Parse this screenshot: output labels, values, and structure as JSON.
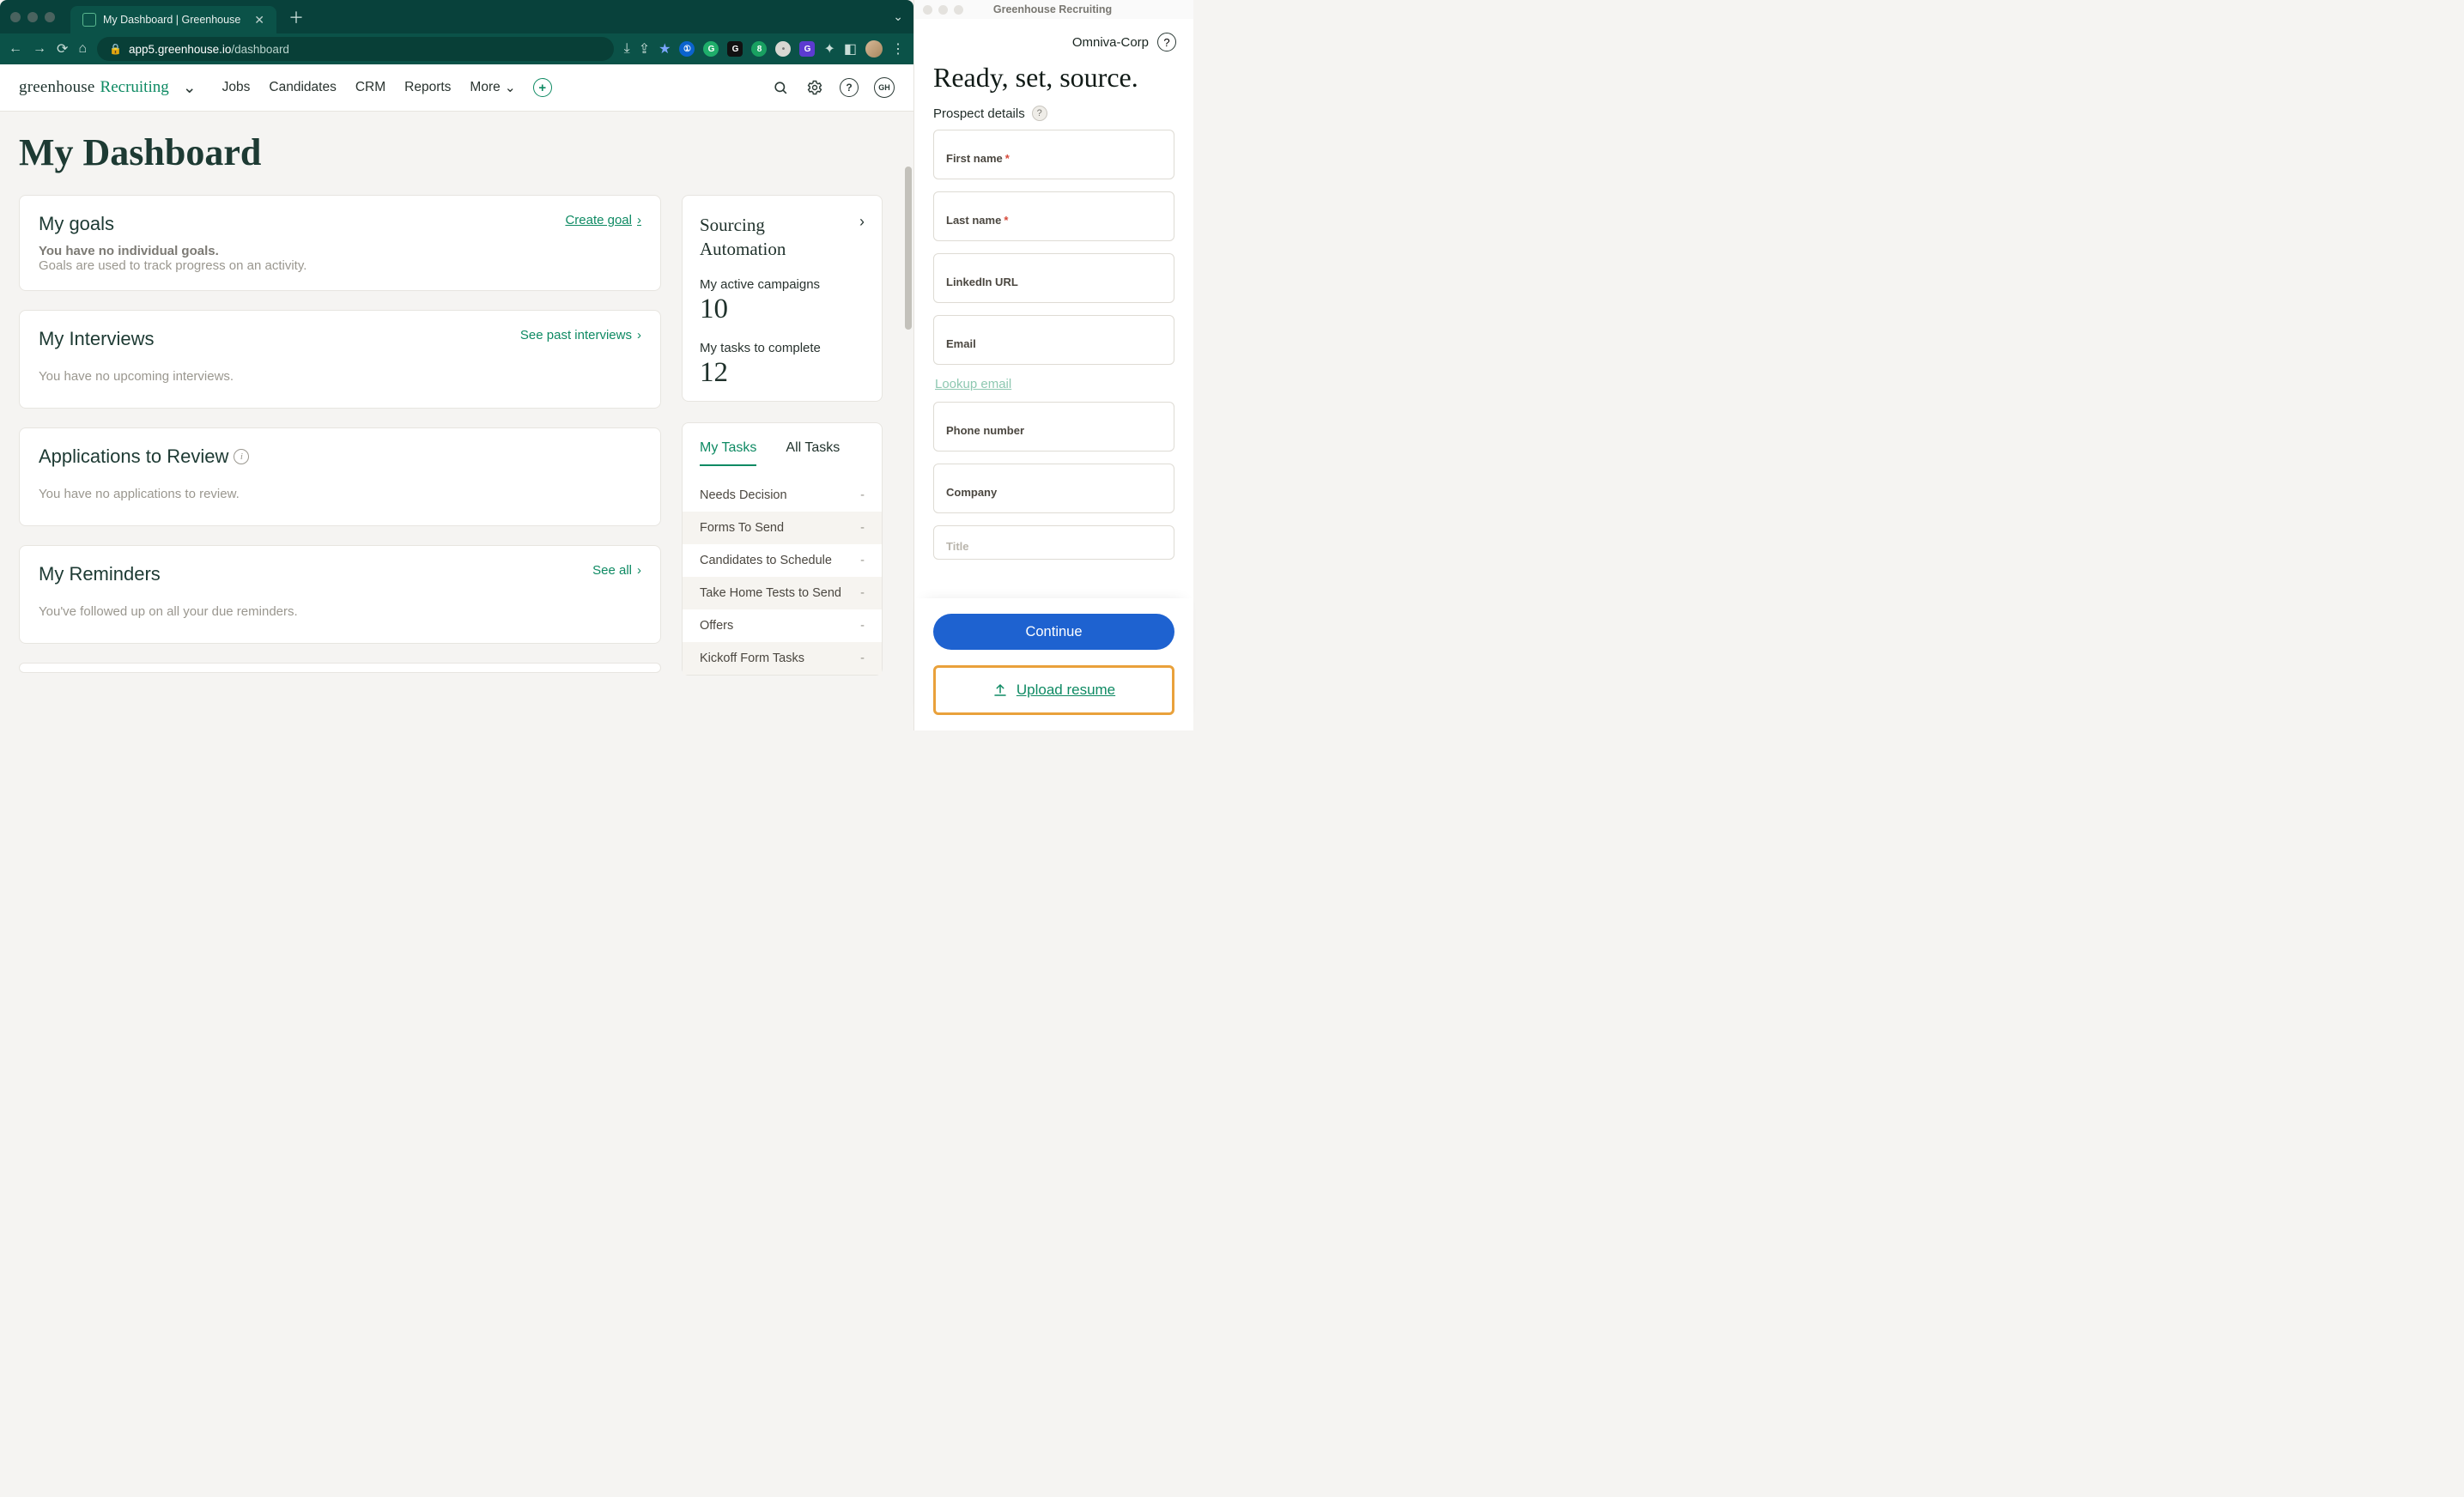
{
  "browser": {
    "tab_title": "My Dashboard | Greenhouse",
    "url_host": "app5.greenhouse.io",
    "url_path": "/dashboard"
  },
  "header": {
    "logo_greenhouse": "greenhouse",
    "logo_recruiting": "Recruiting",
    "nav": {
      "jobs": "Jobs",
      "candidates": "Candidates",
      "crm": "CRM",
      "reports": "Reports",
      "more": "More"
    },
    "avatar_initials": "GH"
  },
  "page": {
    "title": "My Dashboard"
  },
  "goals": {
    "title": "My goals",
    "create_label": "Create goal",
    "empty_strong": "You have no individual goals.",
    "empty_sub": "Goals are used to track progress on an activity."
  },
  "interviews": {
    "title": "My Interviews",
    "link_label": "See past interviews",
    "empty": "You have no upcoming interviews."
  },
  "applications": {
    "title": "Applications to Review",
    "empty": "You have no applications to review."
  },
  "reminders": {
    "title": "My Reminders",
    "link_label": "See all",
    "empty": "You've followed up on all your due reminders."
  },
  "sourcing": {
    "title_line1": "Sourcing",
    "title_line2": "Automation",
    "stat1_label": "My active campaigns",
    "stat1_value": "10",
    "stat2_label": "My tasks to complete",
    "stat2_value": "12"
  },
  "tasks": {
    "tab_my": "My Tasks",
    "tab_all": "All Tasks",
    "rows": [
      {
        "label": "Needs Decision",
        "value": "-"
      },
      {
        "label": "Forms To Send",
        "value": "-"
      },
      {
        "label": "Candidates to Schedule",
        "value": "-"
      },
      {
        "label": "Take Home Tests to Send",
        "value": "-"
      },
      {
        "label": "Offers",
        "value": "-"
      },
      {
        "label": "Kickoff Form Tasks",
        "value": "-"
      }
    ]
  },
  "ext": {
    "window_title": "Greenhouse Recruiting",
    "company": "Omniva-Corp",
    "hero": "Ready, set, source.",
    "section_label": "Prospect details",
    "fields": {
      "first_name": "First name",
      "last_name": "Last name",
      "linkedin": "LinkedIn URL",
      "email": "Email",
      "lookup": "Lookup email",
      "phone": "Phone number",
      "company": "Company",
      "title": "Title"
    },
    "continue_label": "Continue",
    "upload_label": "Upload resume"
  }
}
